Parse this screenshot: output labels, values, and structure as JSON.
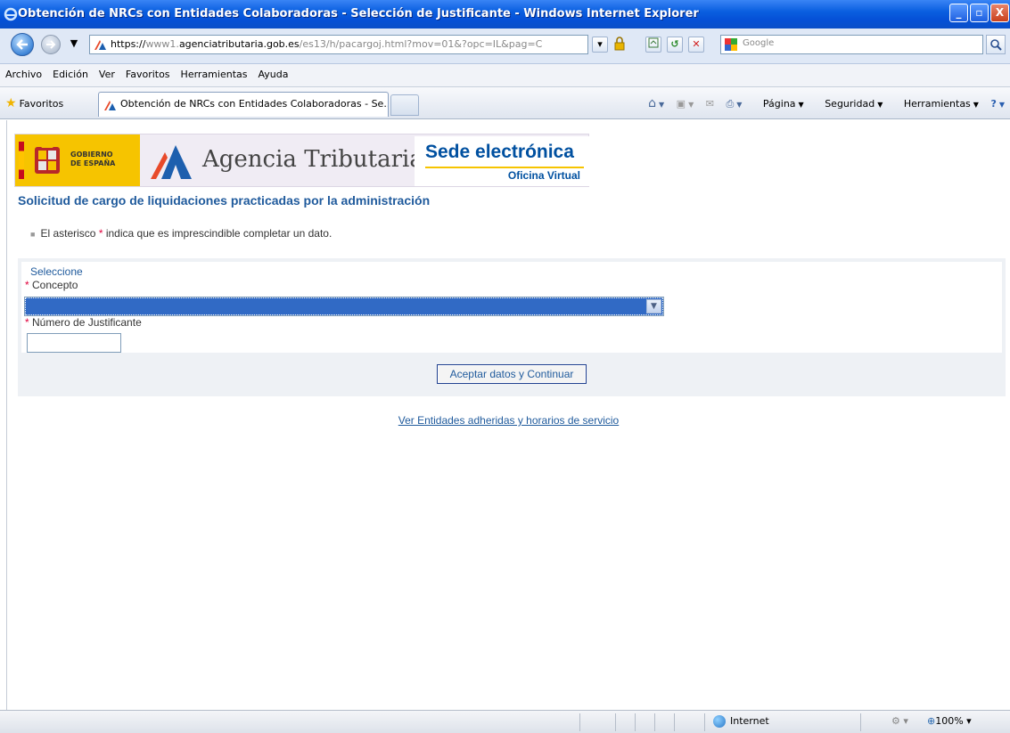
{
  "window": {
    "title": "Obtención de NRCs con Entidades Colaboradoras - Selección de Justificante - Windows Internet Explorer",
    "min": "_",
    "max": "▫",
    "close": "X"
  },
  "address": {
    "proto": "https://",
    "sub": "www1.",
    "host": "agenciatributaria.gob.es",
    "path": "/es13/h/pacargoj.html?mov=01&?opc=IL&pag=C",
    "search_placeholder": "Google"
  },
  "menu": [
    "Archivo",
    "Edición",
    "Ver",
    "Favoritos",
    "Herramientas",
    "Ayuda"
  ],
  "favbar": {
    "favorites": "Favoritos",
    "tab_title": "Obtención de NRCs con Entidades Colaboradoras - Se...",
    "commands": [
      "Página",
      "Seguridad",
      "Herramientas"
    ]
  },
  "banner": {
    "gov_line1": "GOBIERNO",
    "gov_line2": "DE ESPAÑA",
    "agency": "Agencia Tributaria",
    "sede": "Sede electrónica",
    "oficina": "Oficina Virtual"
  },
  "page": {
    "heading": "Solicitud de cargo de liquidaciones practicadas por la administración",
    "note_pre": "El asterisco",
    "note_ast": "*",
    "note_post": "indica que es imprescindible completar un dato.",
    "section": "Seleccione",
    "concepto_label": "Concepto",
    "numero_label": "Número de Justificante",
    "asterisk": "*",
    "submit": "Aceptar datos y Continuar",
    "link": "Ver Entidades adheridas y horarios de servicio"
  },
  "status": {
    "zone": "Internet",
    "zoom": "100%"
  }
}
